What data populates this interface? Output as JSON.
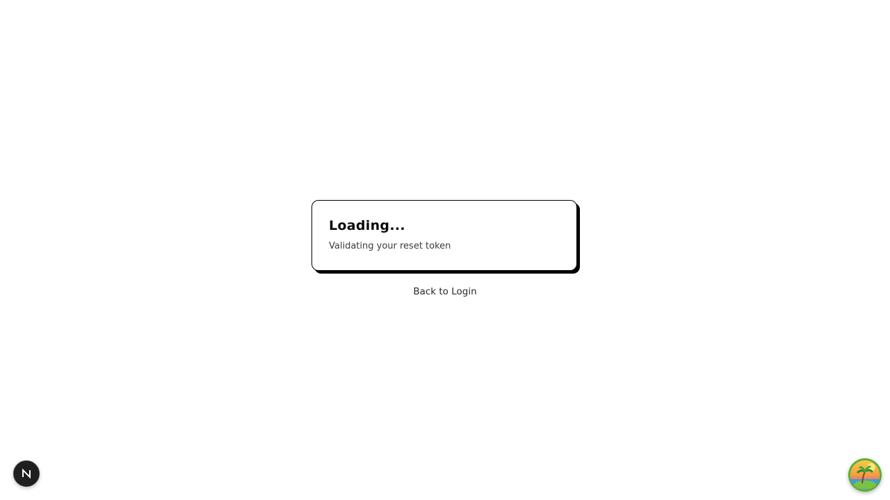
{
  "card": {
    "title": "Loading...",
    "subtitle": "Validating your reset token"
  },
  "links": {
    "back_to_login": "Back to Login"
  },
  "floating": {
    "dev_badge_icon": "nextjs-logo-icon",
    "avatar_icon": "tropical-island-icon"
  },
  "colors": {
    "background": "#ffffff",
    "card_border": "#000000",
    "card_shadow": "#000000",
    "badge_bg": "#1f1f1f"
  }
}
